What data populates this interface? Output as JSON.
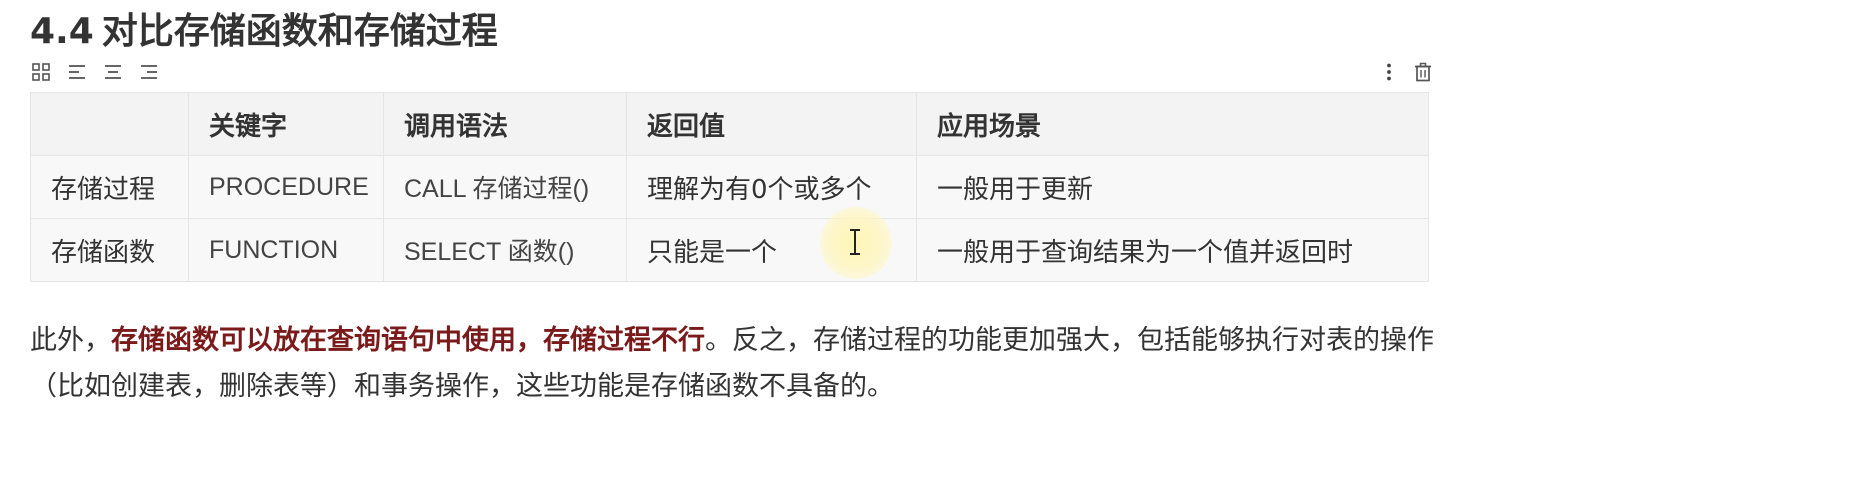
{
  "heading": {
    "number": "4.4",
    "title": "对比存储函数和存储过程"
  },
  "toolbar": {
    "left_icons": [
      "grid-icon",
      "align-left-icon",
      "align-center-icon",
      "align-right-icon"
    ],
    "right_icons": [
      "more-vertical-icon",
      "trash-icon"
    ]
  },
  "table": {
    "headers": [
      "",
      "关键字",
      "调用语法",
      "返回值",
      "应用场景"
    ],
    "rows": [
      [
        "存储过程",
        "PROCEDURE",
        "CALL 存储过程()",
        "理解为有0个或多个",
        "一般用于更新"
      ],
      [
        "存储函数",
        "FUNCTION",
        "SELECT 函数()",
        "只能是一个",
        "一般用于查询结果为一个值并返回时"
      ]
    ]
  },
  "paragraph": {
    "prefix": "此外，",
    "emphasis": "存储函数可以放在查询语句中使用，存储过程不行",
    "suffix": "。反之，存储过程的功能更加强大，包括能够执行对表的操作（比如创建表，删除表等）和事务操作，这些功能是存储函数不具备的。"
  },
  "colors": {
    "text": "#333333",
    "emphasis": "#7a1a1a",
    "header_bg": "#f3f3f3",
    "cell_bg": "#f8f8f8",
    "border": "#e5e5e5",
    "cursor_highlight": "#fff5af"
  }
}
